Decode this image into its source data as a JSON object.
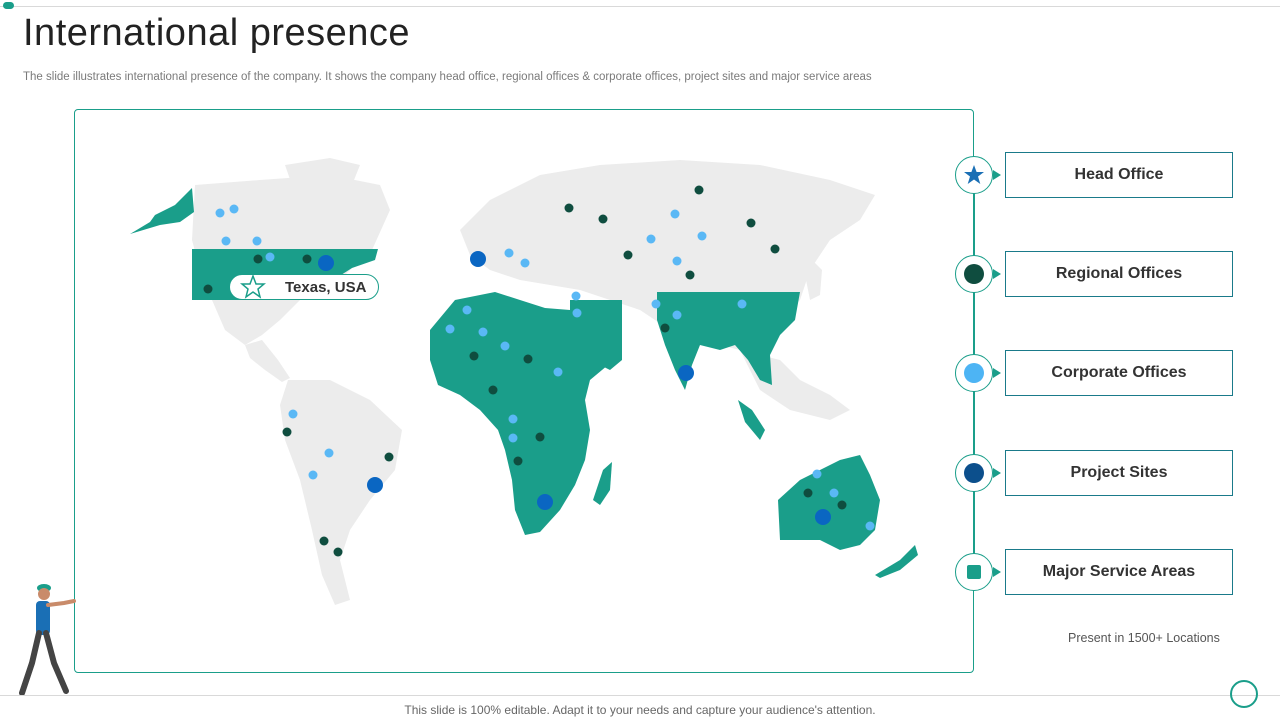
{
  "title": "International presence",
  "subtitle": "The slide illustrates international presence of the company. It shows the company head office, regional offices & corporate offices, project sites and major service areas",
  "map": {
    "head_office_label": "Texas, USA"
  },
  "legend": [
    {
      "label": "Head Office",
      "icon": "star-icon",
      "color": "#1a6fb5"
    },
    {
      "label": "Regional Offices",
      "icon": "dark-dot-icon",
      "color": "#0f4d3f"
    },
    {
      "label": "Corporate Offices",
      "icon": "light-blue-dot-icon",
      "color": "#4db4f4"
    },
    {
      "label": "Project Sites",
      "icon": "dark-blue-dot-icon",
      "color": "#0c4f8c"
    },
    {
      "label": "Major Service Areas",
      "icon": "teal-square-icon",
      "color": "#1a9e8a"
    }
  ],
  "presence_text": "Present in 1500+ Locations",
  "footer": "This slide is 100% editable. Adapt it to your needs and capture your audience's attention.",
  "colors": {
    "accent": "#1a9e8a",
    "land": "#eeeeee",
    "service_area": "#1a9e8a",
    "regional": "#0f4d3f",
    "corporate": "#5ab8f5",
    "project": "#0a66c2"
  }
}
